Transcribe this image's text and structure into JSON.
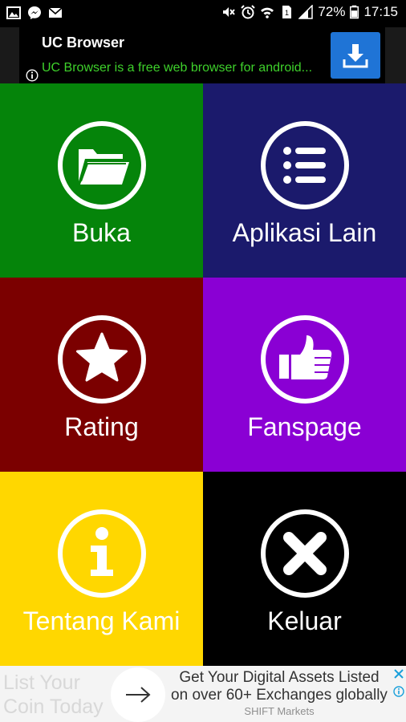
{
  "status_bar": {
    "battery": "72%",
    "time": "17:15",
    "left_icons": [
      "gallery-icon",
      "messenger-icon",
      "email-icon"
    ],
    "right_icons": [
      "mute-icon",
      "alarm-icon",
      "wifi-icon",
      "sim1-icon",
      "signal-icon"
    ]
  },
  "top_ad": {
    "title": "UC Browser",
    "description": "UC Browser is a free web browser for android...",
    "colors": {
      "description": "#3ed12b",
      "download_button": "#1f74d6"
    }
  },
  "tiles": [
    {
      "label": "Buka",
      "icon": "folder-icon",
      "color": "#05840a"
    },
    {
      "label": "Aplikasi Lain",
      "icon": "list-icon",
      "color": "#1b1a6c"
    },
    {
      "label": "Rating",
      "icon": "star-icon",
      "color": "#7b0000"
    },
    {
      "label": "Fanspage",
      "icon": "thumbs-up-icon",
      "color": "#8a00d4"
    },
    {
      "label": "Tentang Kami",
      "icon": "info-icon",
      "color": "#ffd700"
    },
    {
      "label": "Keluar",
      "icon": "close-icon",
      "color": "#000000"
    }
  ],
  "bottom_ad": {
    "left_text": "List Your Coin Today",
    "headline": "Get Your Digital Assets Listed on over 60+ Exchanges globally",
    "brand": "SHIFT Markets"
  }
}
